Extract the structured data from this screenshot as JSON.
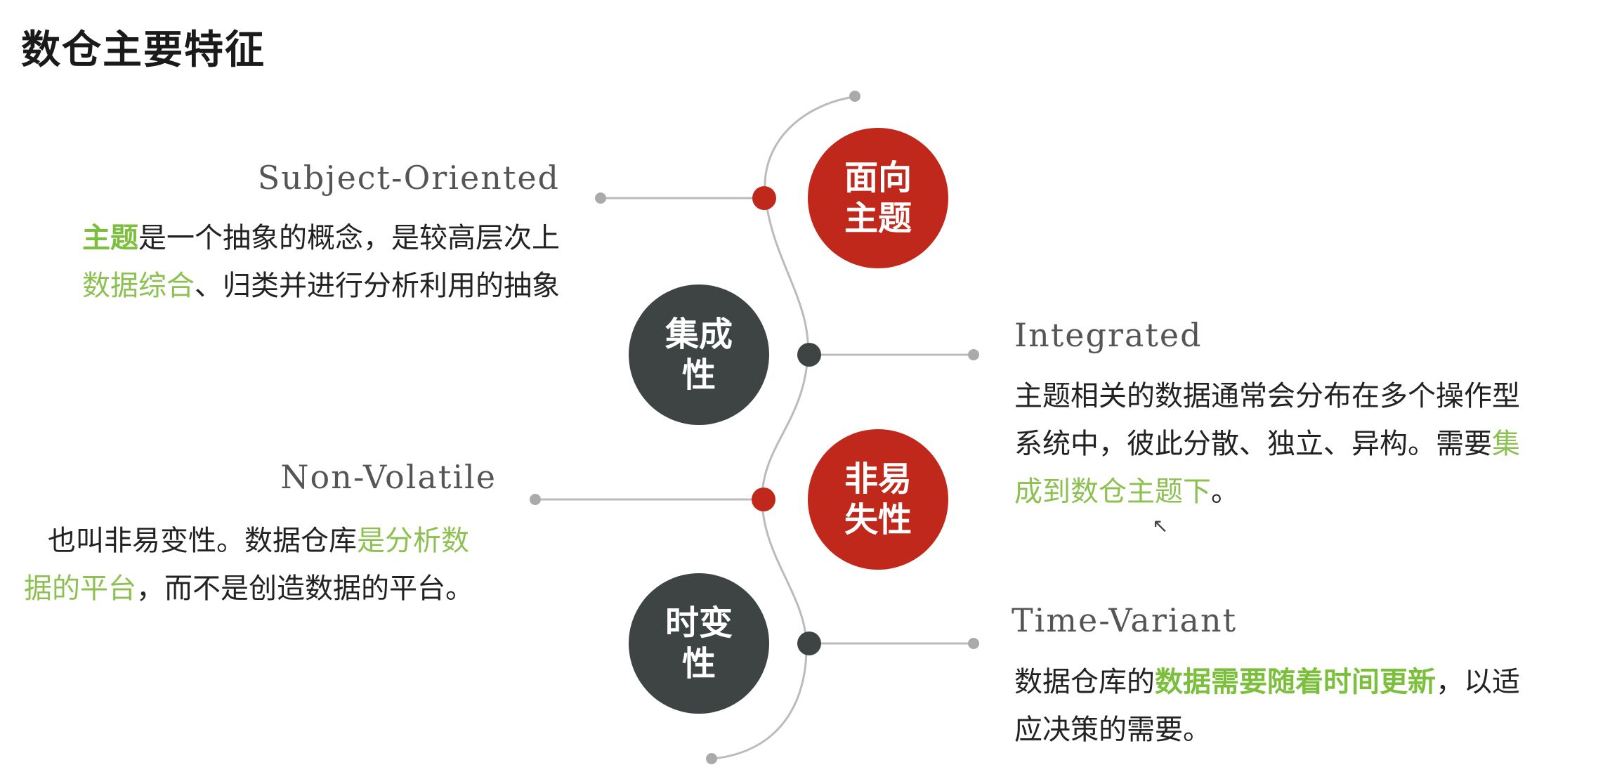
{
  "title": "数仓主要特征",
  "colors": {
    "red": "#c0281c",
    "dark": "#3d4443",
    "line": "#bbbbbb",
    "highlight": "#8cc152"
  },
  "nodes": [
    {
      "id": "subject",
      "line1": "面向",
      "line2": "主题",
      "color": "red"
    },
    {
      "id": "integrated",
      "line1": "集成",
      "line2": "性",
      "color": "dark"
    },
    {
      "id": "nonvolatile",
      "line1": "非易",
      "line2": "失性",
      "color": "red"
    },
    {
      "id": "timevariant",
      "line1": "时变",
      "line2": "性",
      "color": "dark"
    }
  ],
  "subject": {
    "heading": "Subject-Oriented",
    "d1_hl": "主题",
    "d1_rest": "是一个抽象的概念，是较高层次上",
    "d2_hl": "数据综合",
    "d2_rest": "、归类并进行分析利用的抽象"
  },
  "integrated": {
    "heading": "Integrated",
    "d1": "主题相关的数据通常会分布在多个操作型",
    "d2_a": "系统中，彼此分散、独立、异构。需要",
    "d2_hl": "集",
    "d3_hl": "成到数仓主题下",
    "d3_rest": "。"
  },
  "nonvolatile": {
    "heading": "Non-Volatile",
    "d1_a": "也叫非易变性。数据仓库",
    "d1_hl": "是分析数",
    "d2_hl": "据的平台",
    "d2_rest": "，而不是创造数据的平台。"
  },
  "timevariant": {
    "heading": "Time-Variant",
    "d1_a": "数据仓库的",
    "d1_hl": "数据需要随着时间更新",
    "d1_rest": "，以适",
    "d2": "应决策的需要。"
  }
}
